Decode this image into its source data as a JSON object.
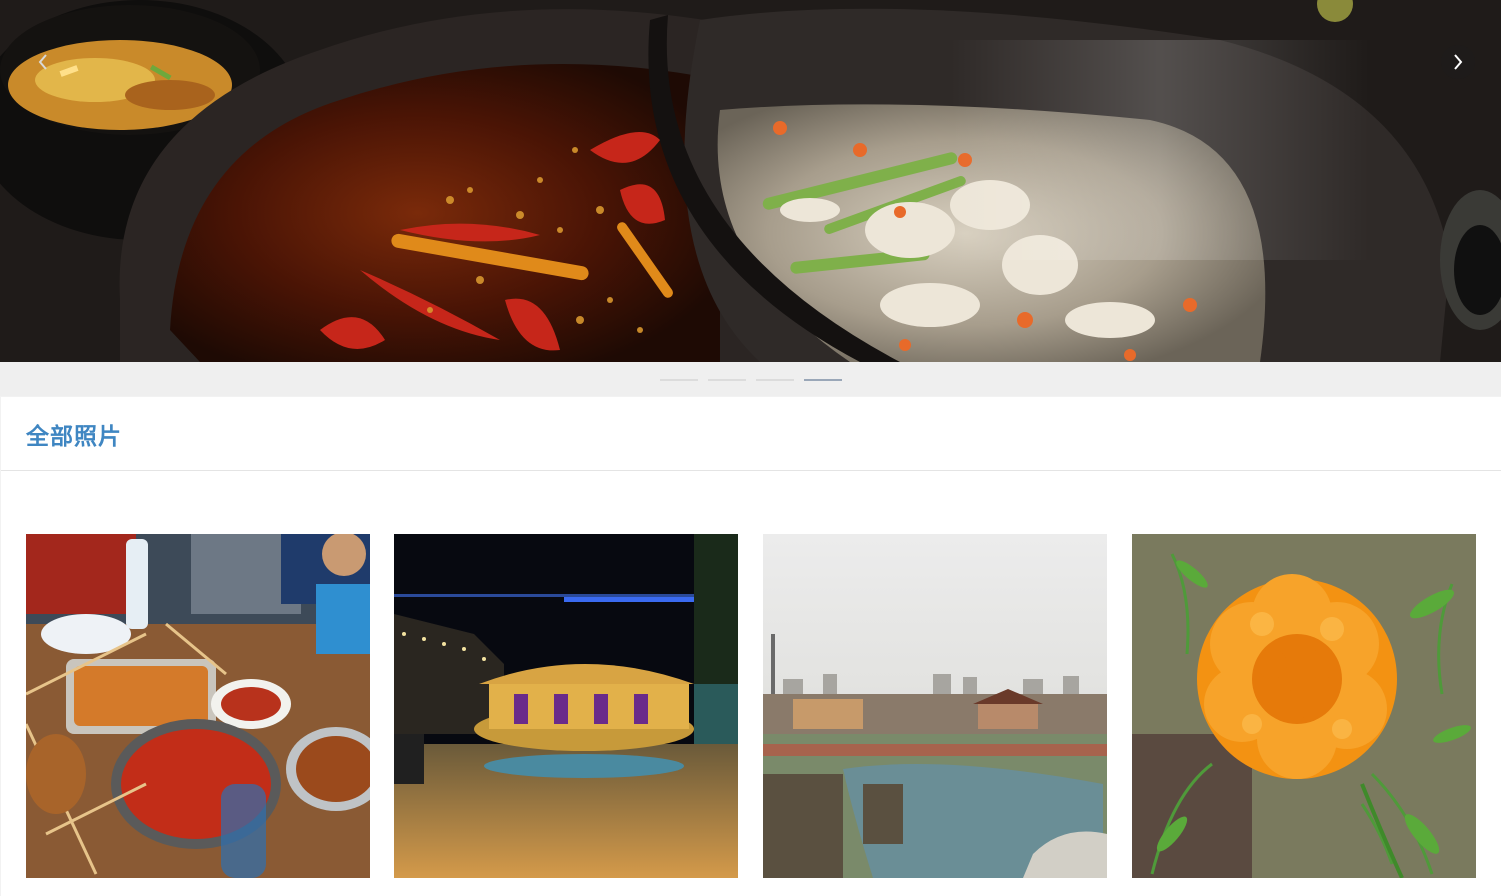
{
  "carousel": {
    "current_slide": 4,
    "slide_count": 4,
    "slide_subject": "hotpot",
    "prev_icon": "chevron-left-icon",
    "next_icon": "chevron-right-icon"
  },
  "gallery": {
    "title": "全部照片",
    "photos": [
      {
        "subject": "street-food-crayfish"
      },
      {
        "subject": "night-carousel-park"
      },
      {
        "subject": "city-lake-view"
      },
      {
        "subject": "orange-marigold"
      }
    ]
  },
  "colors": {
    "title": "#3f86c2",
    "background": "#f2f2f2",
    "dot_inactive": "#dcdcdc",
    "dot_active": "#9aa7b8"
  }
}
